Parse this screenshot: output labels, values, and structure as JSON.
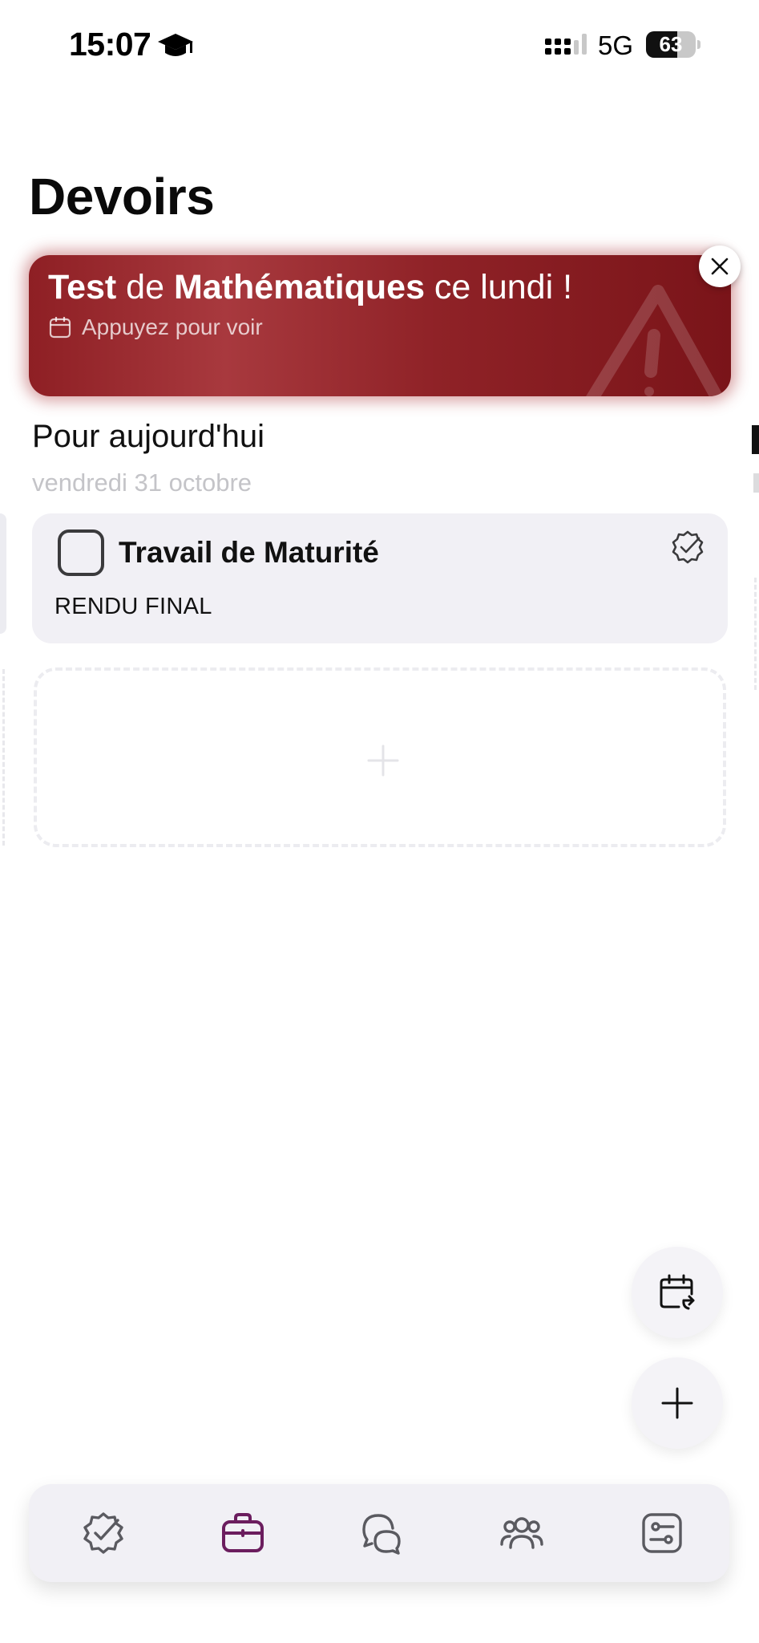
{
  "status_bar": {
    "time": "15:07",
    "network": "5G",
    "battery": "63",
    "battery_level": 0.63
  },
  "page": {
    "title": "Devoirs"
  },
  "alert": {
    "title_bold_1": "Test",
    "title_mid": " de ",
    "title_bold_2": "Mathématiques",
    "title_end": " ce lundi !",
    "subtitle": "Appuyez pour voir",
    "background_color": "#8e1f24"
  },
  "section": {
    "title": "Pour aujourd'hui",
    "date": "vendredi 31 octobre"
  },
  "task": {
    "title": "Travail de Maturité",
    "description": "RENDU FINAL",
    "checked": false
  },
  "tabbar": {
    "active_color": "#6b1d5e",
    "inactive_color": "#5a5a60",
    "active_index": 1,
    "tabs": [
      {
        "icon": "badge-check-icon"
      },
      {
        "icon": "briefcase-icon"
      },
      {
        "icon": "messages-icon"
      },
      {
        "icon": "users-icon"
      },
      {
        "icon": "settings-sliders-icon"
      }
    ]
  }
}
